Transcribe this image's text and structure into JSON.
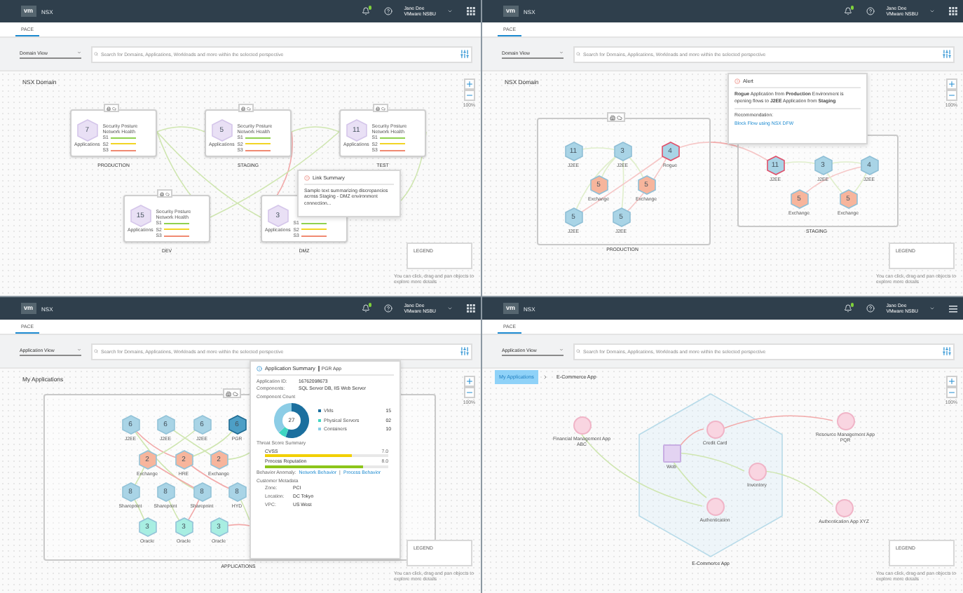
{
  "panels": [
    {
      "header": {
        "logo": "vm",
        "product": "NSX",
        "user_name": "Jane Doe",
        "user_org": "VMware NSBU"
      },
      "tabs": [
        {
          "label": "PACE",
          "selected": true
        }
      ],
      "view_select": "Domain View",
      "search": {
        "placeholder": "Search for Domains, Applications, Workloads and more within the selected perspective"
      },
      "canvas": {
        "kind": "domains",
        "title": "NSX Domain",
        "zoom_level": "100%",
        "legend": "LEGEND",
        "hint": "You can click, drag and pan objects to explore more details",
        "domains": [
          {
            "name": "PRODUCTION",
            "count": "7",
            "count_label": "Applications",
            "posture_label": "Security Posture",
            "health_label": "Network Health",
            "scores": [
              {
                "label": "S1",
                "color": "#8fd14f"
              },
              {
                "label": "S2",
                "color": "#f2d524"
              },
              {
                "label": "S3",
                "color": "#f08a72"
              }
            ]
          },
          {
            "name": "STAGING",
            "count": "5",
            "count_label": "Applications",
            "posture_label": "Security Posture",
            "health_label": "Network Health",
            "scores": [
              {
                "label": "S1",
                "color": "#8fd14f"
              },
              {
                "label": "S2",
                "color": "#f2d524"
              },
              {
                "label": "S3",
                "color": "#f08a72"
              }
            ]
          },
          {
            "name": "TEST",
            "count": "11",
            "count_label": "Applications",
            "posture_label": "Security Posture",
            "health_label": "Network Health",
            "scores": [
              {
                "label": "S1",
                "color": "#8fd14f"
              },
              {
                "label": "S2",
                "color": "#f2d524"
              },
              {
                "label": "S3",
                "color": "#f08a72"
              }
            ]
          },
          {
            "name": "DEV",
            "count": "15",
            "count_label": "Applications",
            "posture_label": "Security Posture",
            "health_label": "Network Health",
            "scores": [
              {
                "label": "S1",
                "color": "#8fd14f"
              },
              {
                "label": "S2",
                "color": "#f2d524"
              },
              {
                "label": "S3",
                "color": "#f08a72"
              }
            ]
          },
          {
            "name": "DMZ",
            "count": "3",
            "count_label": "Applications",
            "scores": [
              {
                "label": "S1",
                "color": "#8fd14f"
              },
              {
                "label": "S2",
                "color": "#f2d524"
              },
              {
                "label": "S3",
                "color": "#f08a72"
              }
            ]
          }
        ],
        "link_summary": {
          "title": "Link Summary",
          "text": "Sample text summarizing discrepancies across Staging - DMZ environment connection..."
        }
      }
    },
    {
      "header": {
        "logo": "vm",
        "product": "NSX",
        "user_name": "Jane Doe",
        "user_org": "VMware NSBU"
      },
      "tabs": [
        {
          "label": "PACE",
          "selected": true
        }
      ],
      "view_select": "Domain View",
      "search": {
        "placeholder": "Search for Domains, Applications, Workloads and more within the selected perspective"
      },
      "canvas": {
        "kind": "domain-detail",
        "title": "NSX Domain",
        "zoom_level": "100%",
        "legend": "LEGEND",
        "hint": "You can click, drag and pan objects to explore more details",
        "groups": [
          {
            "name": "PRODUCTION",
            "nodes": [
              {
                "count": "11",
                "label": "J2EE",
                "color": "#a9d4e6",
                "alert": false
              },
              {
                "count": "3",
                "label": "J2EE",
                "color": "#a9d4e6",
                "alert": false
              },
              {
                "count": "4",
                "label": "Rogue",
                "color": "#a9d4e6",
                "alert": true
              },
              {
                "count": "5",
                "label": "Exchange",
                "color": "#f7b59c",
                "alert": false
              },
              {
                "count": "5",
                "label": "Exchange",
                "color": "#f7b59c",
                "alert": false
              },
              {
                "count": "5",
                "label": "J2EE",
                "color": "#a9d4e6",
                "alert": false
              },
              {
                "count": "5",
                "label": "J2EE",
                "color": "#a9d4e6",
                "alert": false
              }
            ]
          },
          {
            "name": "STAGING",
            "nodes": [
              {
                "count": "11",
                "label": "J2EE",
                "color": "#a9d4e6",
                "alert": true
              },
              {
                "count": "3",
                "label": "J2EE",
                "color": "#a9d4e6",
                "alert": false
              },
              {
                "count": "4",
                "label": "J2EE",
                "color": "#a9d4e6",
                "alert": false
              },
              {
                "count": "5",
                "label": "Exchange",
                "color": "#f7b59c",
                "alert": false
              },
              {
                "count": "5",
                "label": "Exchange",
                "color": "#f7b59c",
                "alert": false
              }
            ]
          }
        ],
        "alert": {
          "title": "Alert",
          "message": "**Rogue** Application from **Production** Environment is opening flows to **J2EE** Application from **Staging**",
          "recommendation_label": "Recommendation:",
          "action": "Block Flow using NSX DFW"
        }
      }
    },
    {
      "header": {
        "logo": "vm",
        "product": "NSX",
        "user_name": "Jane Doe",
        "user_org": "VMware NSBU"
      },
      "tabs": [
        {
          "label": "PACE",
          "selected": true
        }
      ],
      "view_select": "Application View",
      "search": {
        "placeholder": "Search for Domains, Applications, Workloads and more within the selected perspective"
      },
      "canvas": {
        "kind": "applications",
        "title": "My Applications",
        "zoom_level": "100%",
        "legend": "LEGEND",
        "hint": "You can click, drag and pan objects to explore more details",
        "group": "APPLICATIONS",
        "nodes": [
          {
            "count": "6",
            "label": "J2EE",
            "color": "#a9d4e6",
            "selected": false
          },
          {
            "count": "6",
            "label": "J2EE",
            "color": "#a9d4e6",
            "selected": false
          },
          {
            "count": "6",
            "label": "J2EE",
            "color": "#a9d4e6",
            "selected": false
          },
          {
            "count": "6",
            "label": "PGR",
            "color": "#4d9fc6",
            "selected": true
          },
          {
            "count": "2",
            "label": "Exchange",
            "color": "#f7b59c",
            "selected": false
          },
          {
            "count": "2",
            "label": "HRE",
            "color": "#f7b59c",
            "selected": false
          },
          {
            "count": "2",
            "label": "Exchange",
            "color": "#f7b59c",
            "selected": false
          },
          {
            "count": "8",
            "label": "Sharepoint",
            "color": "#a9d4e6",
            "selected": false
          },
          {
            "count": "8",
            "label": "Sharepoint",
            "color": "#a9d4e6",
            "selected": false
          },
          {
            "count": "8",
            "label": "Sharepoint",
            "color": "#a9d4e6",
            "selected": false
          },
          {
            "count": "8",
            "label": "HYD",
            "color": "#a9d4e6",
            "selected": false
          },
          {
            "count": "3",
            "label": "Oracle",
            "color": "#a8eee2",
            "selected": false
          },
          {
            "count": "3",
            "label": "Oracle",
            "color": "#a8eee2",
            "selected": false
          },
          {
            "count": "3",
            "label": "Oracle",
            "color": "#a8eee2",
            "selected": false
          }
        ],
        "summary": {
          "title": "Application Summary",
          "subtitle": "PGR App",
          "fields": [
            {
              "label": "Application ID:",
              "value": "16762098673"
            },
            {
              "label": "Components:",
              "value": "SQL Server DB, IIS Web Server"
            }
          ],
          "component_count_label": "Component Count",
          "component_total": "27",
          "components": [
            {
              "label": "VMs",
              "value": "15",
              "color": "#1b6f9e"
            },
            {
              "label": "Physical Servers",
              "value": "02",
              "color": "#3fd6c2"
            },
            {
              "label": "Containers",
              "value": "10",
              "color": "#8ccde6"
            }
          ],
          "threat_title": "Threat Score Summary",
          "threats": [
            {
              "label": "CVSS",
              "reading": "7.0",
              "level": 0.7,
              "color": "#f2d000"
            },
            {
              "label": "Process Reputation",
              "reading": "8.0",
              "level": 0.8,
              "color": "#8cc51a"
            }
          ],
          "behavior": {
            "label": "Behavior Anomaly:",
            "links": [
              "Network Behavior",
              "Process Behavior"
            ],
            "separator": "|"
          },
          "metadata_title": "Customer Metadata",
          "metadata": [
            {
              "label": "Zone:",
              "value": "PCI"
            },
            {
              "label": "Location:",
              "value": "DC Tokyo"
            },
            {
              "label": "VPC:",
              "value": "US West"
            }
          ]
        }
      }
    },
    {
      "header": {
        "logo": "vm",
        "product": "NSX",
        "user_name": "Jane Doe",
        "user_org": "VMware NSBU"
      },
      "tabs": [
        {
          "label": "PACE",
          "selected": true
        }
      ],
      "view_select": "Application View",
      "search": {
        "placeholder": "Search for Domains, Applications, Workloads and more within the selected perspective"
      },
      "canvas": {
        "kind": "app-detail",
        "breadcrumb": [
          {
            "label": "My Applications",
            "selected": true
          },
          {
            "label": "E-Commerce App",
            "selected": false
          }
        ],
        "zoom_level": "100%",
        "legend": "LEGEND",
        "hint": "You can click, drag and pan objects to explore more details",
        "group": "E-Commerce App",
        "nodes": [
          {
            "label": "Web",
            "kind": "square"
          },
          {
            "label": "Credit Card",
            "kind": "circle"
          },
          {
            "label": "Inventory",
            "kind": "circle"
          },
          {
            "label": "Authentication",
            "kind": "circle"
          },
          {
            "label": "Financial Management App ABC",
            "kind": "circle"
          },
          {
            "label": "Resource Management App PQR",
            "kind": "circle"
          },
          {
            "label": "Authentication App XYZ",
            "kind": "circle"
          }
        ]
      }
    }
  ]
}
